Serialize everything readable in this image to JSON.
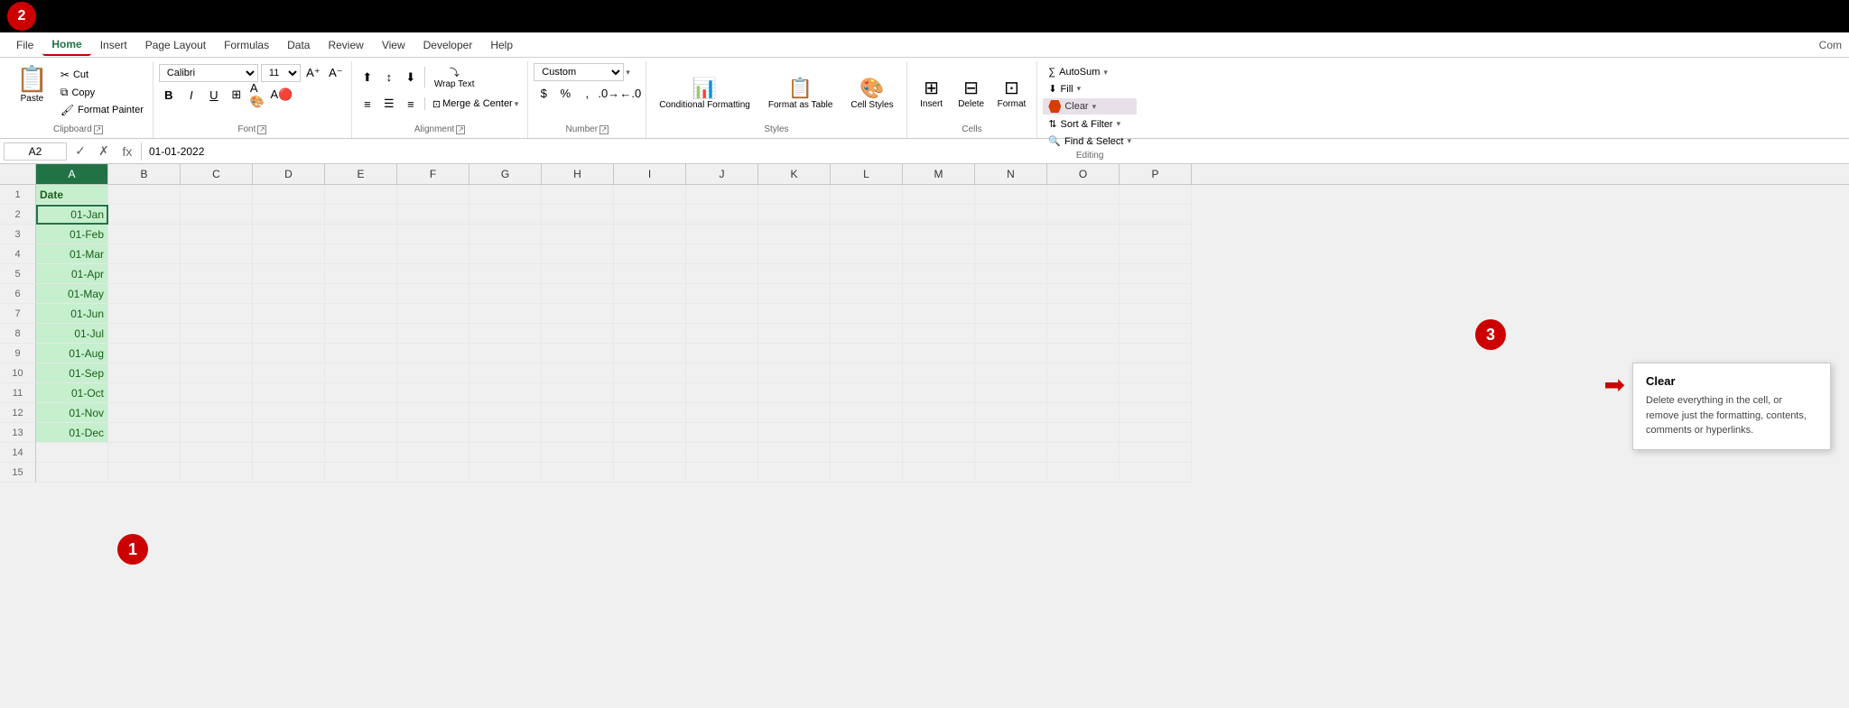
{
  "titlebar": {
    "step2_label": "2"
  },
  "menubar": {
    "items": [
      "File",
      "Home",
      "Insert",
      "Page Layout",
      "Formulas",
      "Data",
      "Review",
      "View",
      "Developer",
      "Help"
    ],
    "active": "Home",
    "comment_label": "Com"
  },
  "ribbon": {
    "clipboard": {
      "paste_label": "Paste",
      "cut_label": "Cut",
      "copy_label": "Copy",
      "format_painter_label": "Format Painter",
      "group_label": "Clipboard"
    },
    "font": {
      "font_name": "Calibri",
      "font_size": "11",
      "bold": "B",
      "italic": "I",
      "underline": "U",
      "group_label": "Font"
    },
    "alignment": {
      "wrap_text_label": "Wrap Text",
      "merge_center_label": "Merge & Center",
      "group_label": "Alignment"
    },
    "number": {
      "format_label": "Custom",
      "group_label": "Number"
    },
    "styles": {
      "conditional_label": "Conditional Formatting",
      "format_table_label": "Format as Table",
      "cell_styles_label": "Cell Styles",
      "group_label": "Styles"
    },
    "cells": {
      "insert_label": "Insert",
      "delete_label": "Delete",
      "format_label": "Format",
      "group_label": "Cells"
    },
    "editing": {
      "autosum_label": "AutoSum",
      "fill_label": "Fill",
      "clear_label": "Clear",
      "sort_filter_label": "Sort & Filter",
      "find_select_label": "Find & Select",
      "group_label": "Editing"
    }
  },
  "formula_bar": {
    "cell_ref": "A2",
    "formula_value": "01-01-2022",
    "fx_label": "fx"
  },
  "spreadsheet": {
    "columns": [
      "A",
      "B",
      "C",
      "D",
      "E",
      "F",
      "G",
      "H",
      "I",
      "J",
      "K",
      "L",
      "M",
      "N",
      "O",
      "P"
    ],
    "rows": [
      {
        "num": "1",
        "a": "Date",
        "is_header": true
      },
      {
        "num": "2",
        "a": "01-Jan",
        "selected": true
      },
      {
        "num": "3",
        "a": "01-Feb"
      },
      {
        "num": "4",
        "a": "01-Mar"
      },
      {
        "num": "5",
        "a": "01-Apr"
      },
      {
        "num": "6",
        "a": "01-May"
      },
      {
        "num": "7",
        "a": "01-Jun"
      },
      {
        "num": "8",
        "a": "01-Jul"
      },
      {
        "num": "9",
        "a": "01-Aug"
      },
      {
        "num": "10",
        "a": "01-Sep"
      },
      {
        "num": "11",
        "a": "01-Oct"
      },
      {
        "num": "12",
        "a": "01-Nov"
      },
      {
        "num": "13",
        "a": "01-Dec"
      },
      {
        "num": "14",
        "a": ""
      },
      {
        "num": "15",
        "a": ""
      }
    ]
  },
  "tooltip": {
    "title": "Clear",
    "body": "Delete everything in the cell, or remove just the formatting, contents, comments or hyperlinks."
  },
  "badges": {
    "step1": "1",
    "step2": "2",
    "step3": "3"
  }
}
